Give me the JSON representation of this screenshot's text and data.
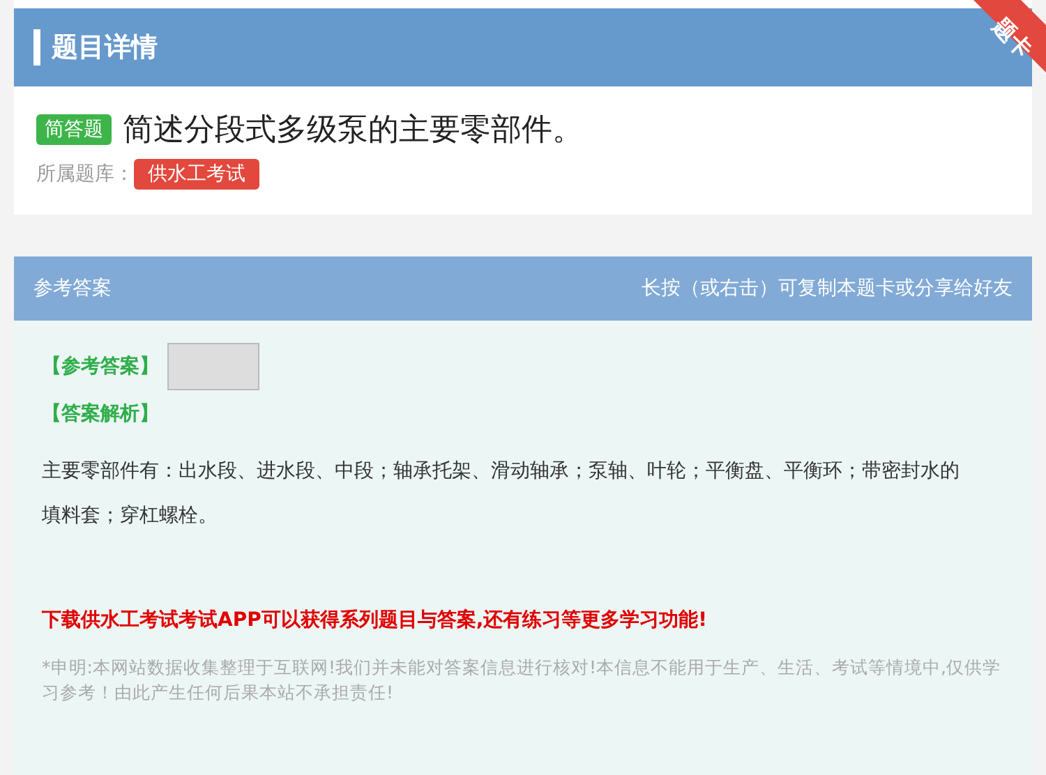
{
  "header": {
    "title": "题目详情",
    "ribbon": "题卡"
  },
  "question": {
    "type_badge": "简答题",
    "text": "简述分段式多级泵的主要零部件。",
    "bank_label": "所属题库：",
    "bank_tag": "供水工考试"
  },
  "answer_panel": {
    "title": "参考答案",
    "hint": "长按（或右击）可复制本题卡或分享给好友",
    "answer_label": "【参考答案】",
    "analysis_label": "【答案解析】",
    "analysis_text": "主要零部件有：出水段、进水段、中段；轴承托架、滑动轴承；泵轴、叶轮；平衡盘、平衡环；带密封水的填料套；穿杠螺栓。",
    "promo": "下载供水工考试考试APP可以获得系列题目与答案,还有练习等更多学习功能!",
    "disclaimer": "*申明:本网站数据收集整理于互联网!我们并未能对答案信息进行核对!本信息不能用于生产、生活、考试等情境中,仅供学习参考！由此产生任何后果本站不承担责任!"
  }
}
